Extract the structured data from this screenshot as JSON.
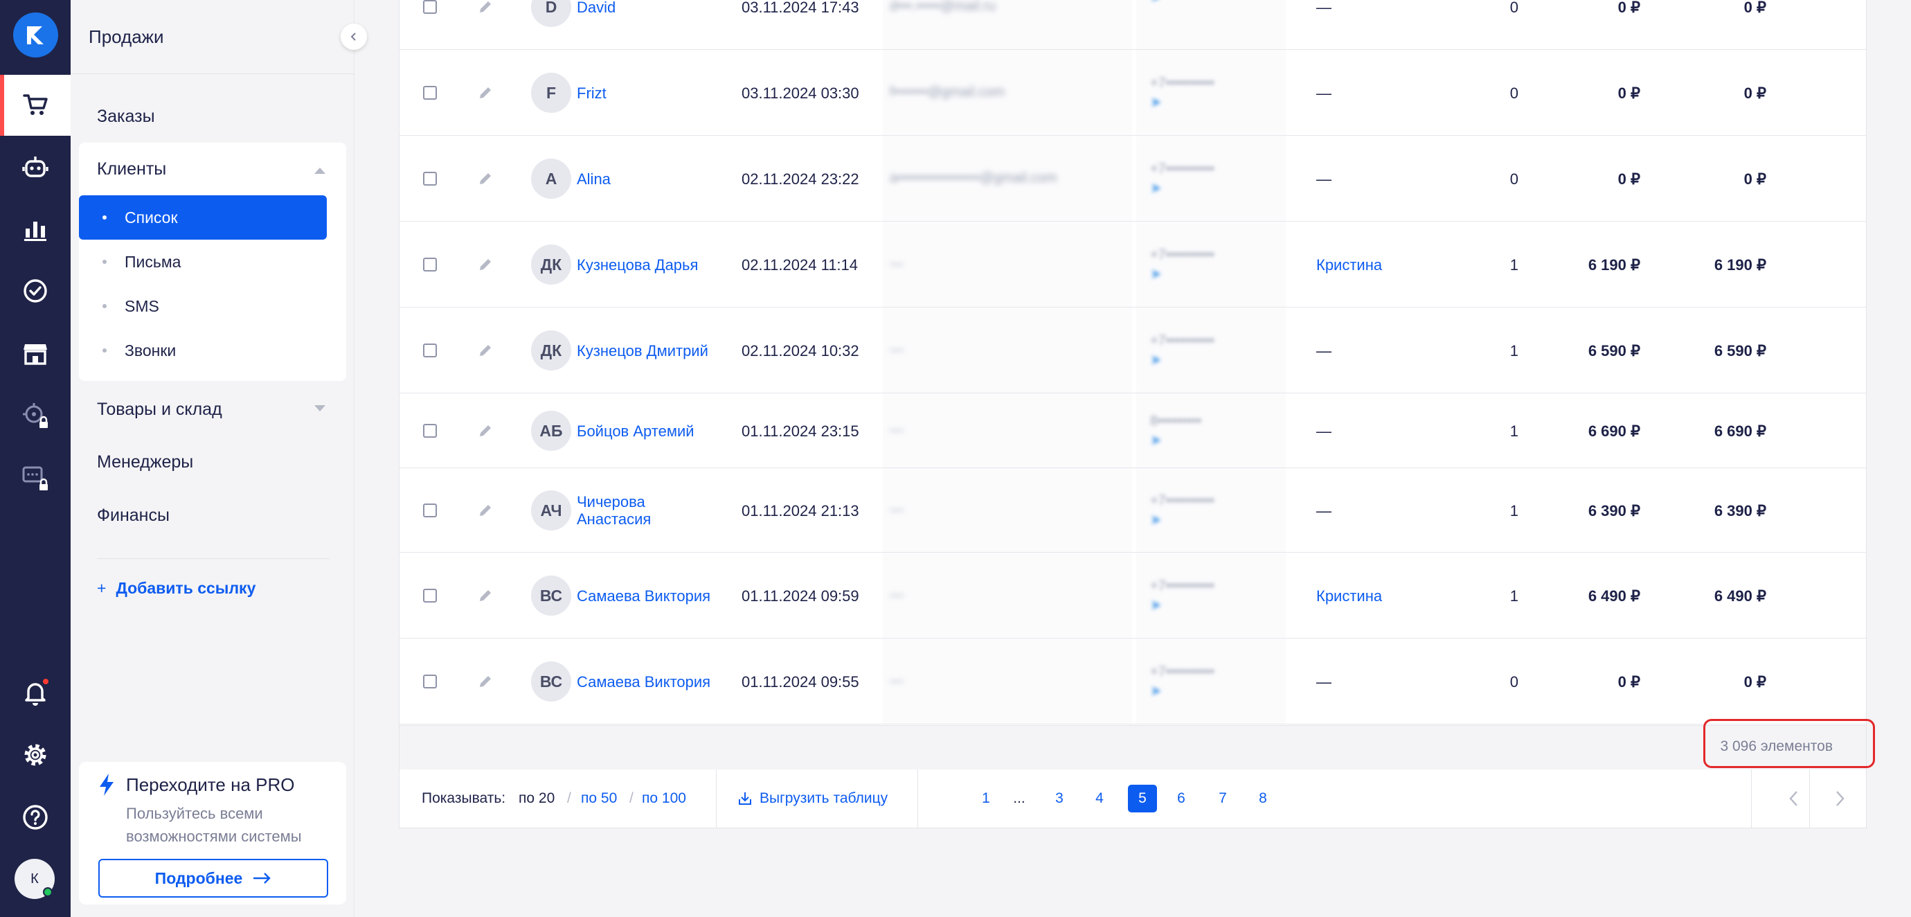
{
  "sidebar": {
    "title": "Продажи",
    "items": [
      {
        "label": "Заказы"
      },
      {
        "label": "Клиенты"
      },
      {
        "label": "Товары и склад"
      },
      {
        "label": "Менеджеры"
      },
      {
        "label": "Финансы"
      }
    ],
    "clients_sub": [
      {
        "label": "Список"
      },
      {
        "label": "Письма"
      },
      {
        "label": "SMS"
      },
      {
        "label": "Звонки"
      }
    ],
    "add_link": "Добавить ссылку",
    "add_link_icon": "+"
  },
  "pro": {
    "title": "Переходите на PRO",
    "description": "Пользуйтесь всеми возможностями системы",
    "button": "Подробнее"
  },
  "user": {
    "initial": "К"
  },
  "table": {
    "rows": [
      {
        "initials": "D",
        "name": "David",
        "date": "03.11.2024 17:43",
        "email": "d•••.•••••@mail.ru",
        "phone": "",
        "manager": "—",
        "orders": "0",
        "sum": "0 ₽",
        "total": "0 ₽"
      },
      {
        "initials": "F",
        "name": "Frizt",
        "date": "03.11.2024 03:30",
        "email": "f•••••••@gmail.com",
        "phone": "+7••••••••••",
        "manager": "—",
        "orders": "0",
        "sum": "0 ₽",
        "total": "0 ₽"
      },
      {
        "initials": "A",
        "name": "Alina",
        "date": "02.11.2024 23:22",
        "email": "a•••••••••••••••••@gmail.com",
        "phone": "+7••••••••••",
        "manager": "—",
        "orders": "0",
        "sum": "0 ₽",
        "total": "0 ₽"
      },
      {
        "initials": "ДК",
        "name": "Кузнецова Дарья",
        "date": "02.11.2024 11:14",
        "email": "—",
        "phone": "+7••••••••••",
        "manager": "Кристина",
        "orders": "1",
        "sum": "6 190 ₽",
        "total": "6 190 ₽"
      },
      {
        "initials": "ДК",
        "name": "Кузнецов Дмитрий",
        "date": "02.11.2024 10:32",
        "email": "—",
        "phone": "+7••••••••••",
        "manager": "—",
        "orders": "1",
        "sum": "6 590 ₽",
        "total": "6 590 ₽"
      },
      {
        "initials": "АБ",
        "name": "Бойцов Артемий",
        "date": "01.11.2024 23:15",
        "email": "—",
        "phone": "8•••••••••",
        "manager": "—",
        "orders": "1",
        "sum": "6 690 ₽",
        "total": "6 690 ₽"
      },
      {
        "initials": "АЧ",
        "name": "Чичерова Анастасия",
        "date": "01.11.2024 21:13",
        "email": "—",
        "phone": "+7••••••••••",
        "manager": "—",
        "orders": "1",
        "sum": "6 390 ₽",
        "total": "6 390 ₽"
      },
      {
        "initials": "ВС",
        "name": "Самаева Виктория",
        "date": "01.11.2024 09:59",
        "email": "—",
        "phone": "+7••••••••••",
        "manager": "Кристина",
        "orders": "1",
        "sum": "6 490 ₽",
        "total": "6 490 ₽"
      },
      {
        "initials": "ВС",
        "name": "Самаева Виктория",
        "date": "01.11.2024 09:55",
        "email": "—",
        "phone": "+7••••••••••",
        "manager": "—",
        "orders": "0",
        "sum": "0 ₽",
        "total": "0 ₽"
      }
    ],
    "total_count": "3 096 элементов"
  },
  "footer": {
    "show_label": "Показывать:",
    "per_page": [
      "по 20",
      "по 50",
      "по 100"
    ],
    "per_page_separator": "/",
    "export": "Выгрузить таблицу",
    "pages": [
      "1",
      "...",
      "3",
      "4",
      "5",
      "6",
      "7",
      "8"
    ],
    "current_page": "5"
  },
  "colors": {
    "rail": "#1f2347",
    "accent": "#0d5cf0",
    "active_marker": "#ff4d4d",
    "highlight": "#e3282a"
  }
}
